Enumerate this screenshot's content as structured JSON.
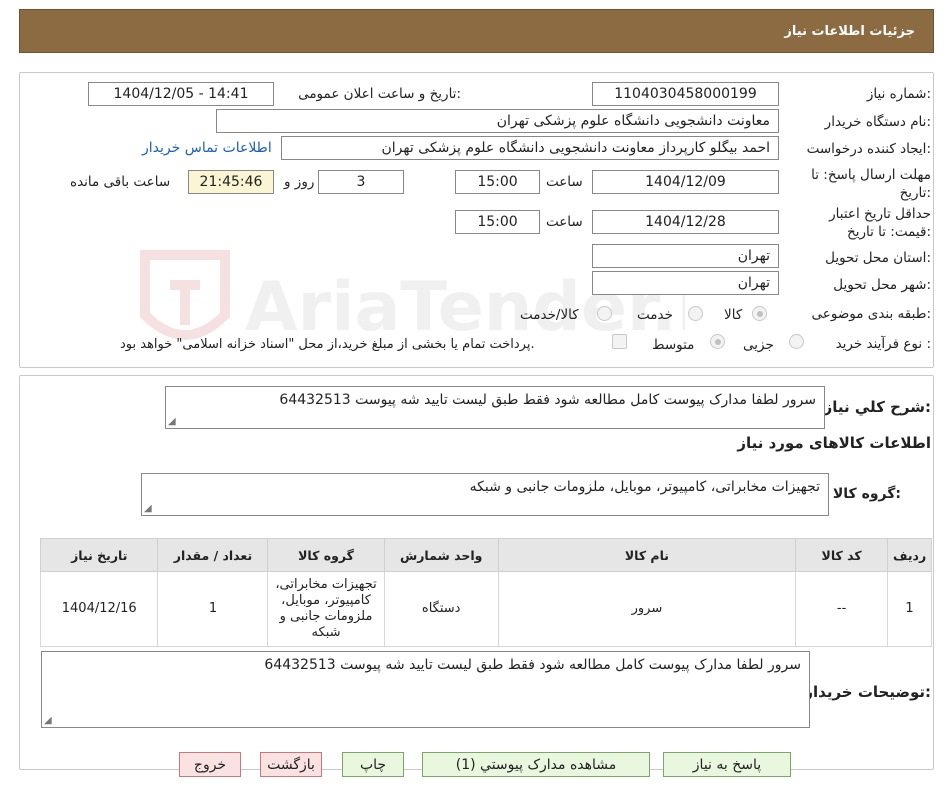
{
  "header": {
    "title": "جزئیات اطلاعات نیاز"
  },
  "details": {
    "need_number_label": "شماره نیاز:",
    "need_number": "1104030458000199",
    "announce_label": "تاریخ و ساعت اعلان عمومی:",
    "announce_value": "1404/12/05 - 14:41",
    "buyer_org_label": "نام دستگاه خریدار:",
    "buyer_org": "معاونت دانشجویی دانشگاه علوم پزشکی تهران",
    "creator_label": "ایجاد کننده درخواست:",
    "creator": "احمد بیگلو کارپرداز معاونت دانشجویی دانشگاه علوم پزشکی تهران",
    "contact_link": "اطلاعات تماس خریدار",
    "deadline_label_1": "مهلت ارسال پاسخ: تا",
    "deadline_label_2": "تاریخ:",
    "deadline_date": "1404/12/09",
    "time_word": "ساعت",
    "deadline_time": "15:00",
    "days_value": "3",
    "days_label": "روز و",
    "remaining_time": "21:45:46",
    "remaining_label": "ساعت باقی مانده",
    "validity_label_1": "حداقل تاریخ اعتبار",
    "validity_label_2": "قیمت: تا تاریخ:",
    "validity_date": "1404/12/28",
    "validity_time": "15:00",
    "province_label": "استان محل تحویل:",
    "province": "تهران",
    "city_label": "شهر محل تحویل:",
    "city": "تهران",
    "category_label": "طبقه بندی موضوعی:",
    "category_options": [
      "کالا",
      "خدمت",
      "کالا/خدمت"
    ],
    "process_label": "نوع فرآیند خرید :",
    "process_options": [
      "جزیی",
      "متوسط"
    ],
    "payment_note": "پرداخت تمام یا بخشی از مبلغ خرید،از محل \"اسناد خزانه اسلامی\" خواهد بود."
  },
  "summary": {
    "label": "شرح کلي نياز:",
    "text": "سرور لطفا مدارک پیوست کامل مطالعه شود فقط طبق لیست تایید شه پیوست 64432513",
    "goods_title": "اطلاعات کالاهای مورد نیاز",
    "group_label": "گروه کالا:",
    "group_value": "تجهیزات مخابراتی، کامپیوتر، موبایل، ملزومات جانبی و شبکه"
  },
  "table": {
    "headers": [
      "ردیف",
      "کد کالا",
      "نام کالا",
      "واحد شمارش",
      "گروه کالا",
      "تعداد / مقدار",
      "تاریخ نیاز"
    ],
    "rows": [
      {
        "row": "1",
        "code": "--",
        "name": "سرور",
        "unit": "دستگاه",
        "group_lines": [
          "تجهیزات مخابراتی،",
          "کامپیوتر، موبایل،",
          "ملزومات جانبی و",
          "شبکه"
        ],
        "qty": "1",
        "date": "1404/12/16"
      }
    ]
  },
  "buyer_notes": {
    "label": "توضیحات خریدار:",
    "text": "سرور لطفا مدارک پیوست کامل مطالعه شود فقط طبق لیست تایید شه پیوست 64432513"
  },
  "buttons": {
    "reply": "پاسخ به نیاز",
    "attachments": "مشاهده مدارک پیوستي (1)",
    "print": "چاپ",
    "back": "بازگشت",
    "exit": "خروج"
  },
  "watermark": {
    "text": "AriaTender.neT"
  }
}
